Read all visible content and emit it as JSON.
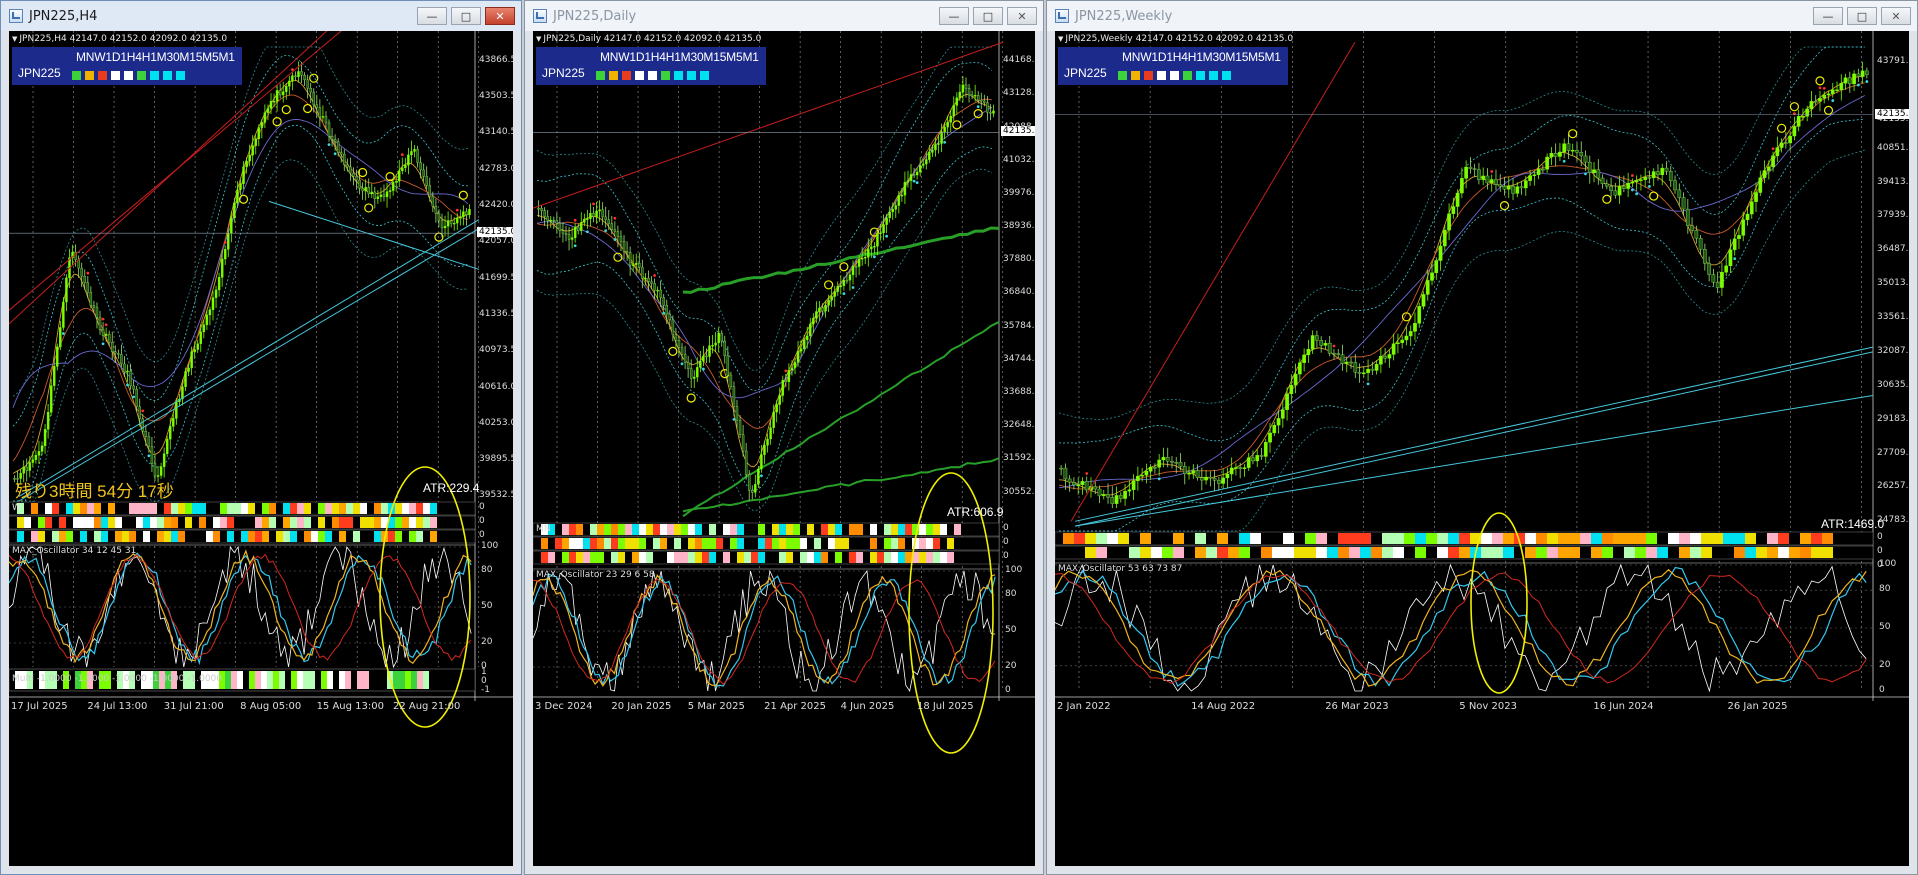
{
  "windows": [
    {
      "id": "h4",
      "title": "JPN225,H4",
      "ohlc_text": "JPN225,H4  42147.0 42152.0 42092.0 42135.0",
      "legend": {
        "timeframes": "MNW1D1H4H1M30M15M5M1",
        "symbol": "JPN225",
        "squares": [
          "#3cd23c",
          "#f0b400",
          "#e83c1e",
          "#ffffff",
          "#ffffff",
          "#3cd23c",
          "#00e1f0",
          "#00e1f0",
          "#00e1f0"
        ]
      },
      "price_levels": [
        "43866.5",
        "43503.5",
        "43140.5",
        "42783.0",
        "42420.0",
        "42057.0",
        "41699.5",
        "41336.5",
        "40973.5",
        "40616.0",
        "40253.0",
        "39895.5",
        "39532.5"
      ],
      "current_price": "42135.0",
      "timer": "残り3時間 54分 17秒",
      "atr": "ATR:229.4",
      "oscillator_label": "MAX_Oscillator 34 12 45 31",
      "osc_levels": [
        "100",
        "80",
        "50",
        "20",
        "0"
      ],
      "multi_label": "Multi -1.0000 -1.0000 -1.0000 -1.0000 -1.0000",
      "multi_levels": [
        "1",
        "0",
        "-1"
      ],
      "strip_labels": [
        "W",
        "",
        ""
      ],
      "dates": [
        "17 Jul 2025",
        "24 Jul 13:00",
        "31 Jul 21:00",
        "8 Aug 05:00",
        "15 Aug 13:00",
        "22 Aug 21:00"
      ]
    },
    {
      "id": "d1",
      "title": "JPN225,Daily",
      "ohlc_text": "JPN225,Daily  42147.0 42152.0 42092.0 42135.0",
      "legend": {
        "timeframes": "MNW1D1H4H1M30M15M5M1",
        "symbol": "JPN225",
        "squares": [
          "#3cd23c",
          "#f0b400",
          "#e83c1e",
          "#ffffff",
          "#ffffff",
          "#3cd23c",
          "#00e1f0",
          "#00e1f0",
          "#00e1f0"
        ]
      },
      "price_levels": [
        "44168.0",
        "43128.0",
        "42088.0",
        "41032.0",
        "39976.0",
        "38936.0",
        "37880.0",
        "36840.0",
        "35784.0",
        "34744.0",
        "33688.0",
        "32648.0",
        "31592.0",
        "30552.0"
      ],
      "current_price": "42135.0",
      "atr": "ATR:606.9",
      "oscillator_label": "MAX_Oscillator 23 29 6 58",
      "osc_levels": [
        "100",
        "80",
        "50",
        "20",
        "0"
      ],
      "strip_labels": [
        "MN",
        "",
        ""
      ],
      "dates": [
        "3 Dec 2024",
        "20 Jan 2025",
        "5 Mar 2025",
        "21 Apr 2025",
        "4 Jun 2025",
        "18 Jul 2025"
      ]
    },
    {
      "id": "w1",
      "title": "JPN225,Weekly",
      "ohlc_text": "JPN225,Weekly  42147.0 42152.0 42092.0 42135.0",
      "legend": {
        "timeframes": "MNW1D1H4H1M30M15M5M1",
        "symbol": "JPN225",
        "squares": [
          "#3cd23c",
          "#f0b400",
          "#e83c1e",
          "#ffffff",
          "#ffffff",
          "#3cd23c",
          "#00e1f0",
          "#00e1f0",
          "#00e1f0"
        ]
      },
      "price_levels": [
        "43791.0",
        "42135.0",
        "40851.0",
        "39413.0",
        "37939.0",
        "36487.0",
        "35013.0",
        "33561.0",
        "32087.0",
        "30635.0",
        "29183.0",
        "27709.0",
        "26257.0",
        "24783.0"
      ],
      "current_price": "42135.0",
      "atr": "ATR:1469.0",
      "oscillator_label": "MAX_Oscillator 53 63 73 87",
      "osc_levels": [
        "100",
        "80",
        "50",
        "20",
        "0"
      ],
      "strip_labels": [
        "",
        "",
        ""
      ],
      "dates": [
        "2 Jan 2022",
        "14 Aug 2022",
        "26 Mar 2023",
        "5 Nov 2023",
        "16 Jun 2024",
        "26 Jan 2025"
      ]
    }
  ],
  "colors": {
    "candle_up": "#7cfc00",
    "candle_down": "#ffffff",
    "bollinger": "#3cc8d2",
    "trend_red": "#c81e1e",
    "trend_cyan": "#46c8dc",
    "ma_green": "#28a028",
    "highlight_ellipse": "#f0f000",
    "osc_white": "#ffffff",
    "osc_cyan": "#32c8f0",
    "osc_orange": "#f0b41e",
    "osc_red": "#d2281e"
  }
}
